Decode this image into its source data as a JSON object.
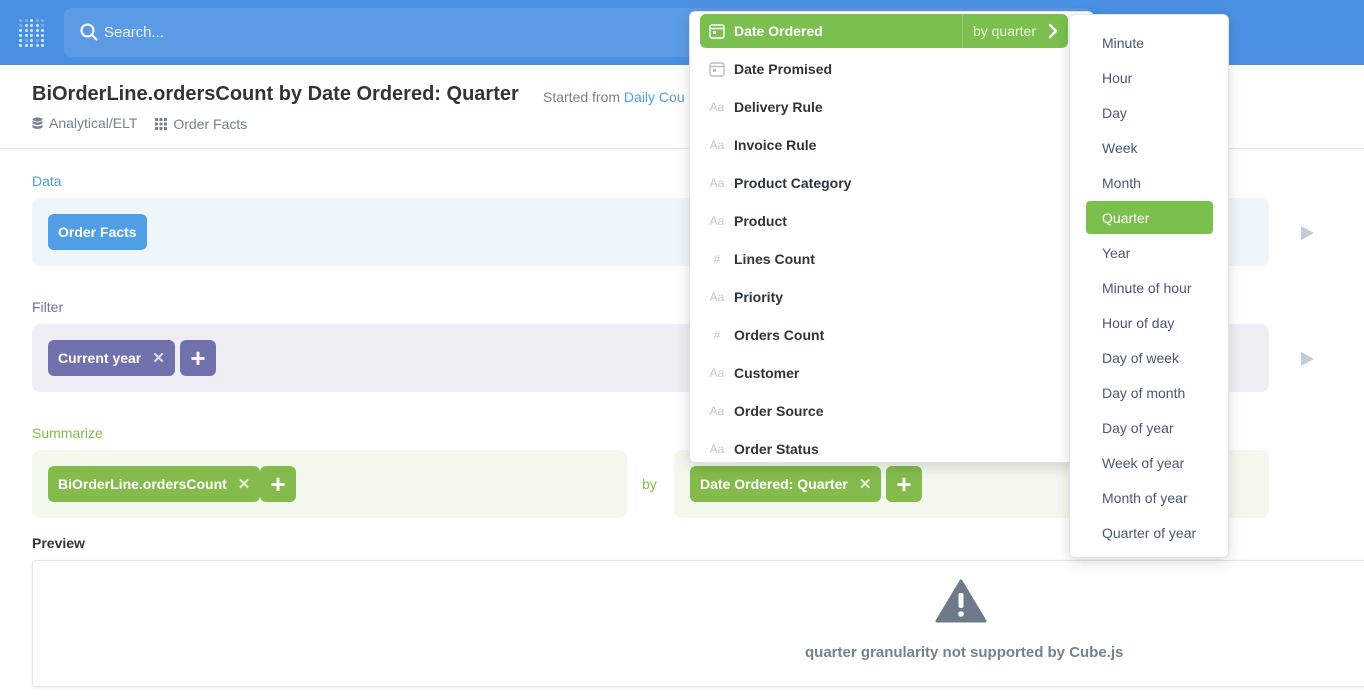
{
  "search": {
    "placeholder": "Search..."
  },
  "header": {
    "title": "BiOrderLine.ordersCount by Date Ordered: Quarter",
    "started_from": "Started from",
    "started_link": "Daily Cou",
    "crumbs": [
      {
        "label": "Analytical/ELT",
        "icon": "database-icon"
      },
      {
        "label": "Order Facts",
        "icon": "grid-icon"
      }
    ]
  },
  "sections": {
    "data": {
      "label": "Data",
      "pill": "Order Facts",
      "color": "#509ee3"
    },
    "filter": {
      "label": "Filter",
      "pill": "Current year",
      "color": "#7172ad"
    },
    "summarize": {
      "label": "Summarize",
      "metric": "BiOrderLine.ordersCount",
      "by": "by",
      "breakout": "Date Ordered: Quarter",
      "color": "#84bb4c"
    }
  },
  "preview": {
    "label": "Preview",
    "error": "quarter granularity not supported by Cube.js"
  },
  "dimension_menu": {
    "items": [
      {
        "label": "Date Ordered",
        "icon": "calendar-icon",
        "active": true,
        "by": "by quarter"
      },
      {
        "label": "Date Promised",
        "icon": "calendar-icon"
      },
      {
        "label": "Delivery Rule",
        "icon": "text-icon",
        "glyph": "Aa"
      },
      {
        "label": "Invoice Rule",
        "icon": "text-icon",
        "glyph": "Aa"
      },
      {
        "label": "Product Category",
        "icon": "text-icon",
        "glyph": "Aa"
      },
      {
        "label": "Product",
        "icon": "text-icon",
        "glyph": "Aa"
      },
      {
        "label": "Lines Count",
        "icon": "number-icon",
        "glyph": "#"
      },
      {
        "label": "Priority",
        "icon": "text-icon",
        "glyph": "Aa"
      },
      {
        "label": "Orders Count",
        "icon": "number-icon",
        "glyph": "#"
      },
      {
        "label": "Customer",
        "icon": "text-icon",
        "glyph": "Aa"
      },
      {
        "label": "Order Source",
        "icon": "text-icon",
        "glyph": "Aa"
      },
      {
        "label": "Order Status",
        "icon": "text-icon",
        "glyph": "Aa"
      }
    ]
  },
  "granularity_menu": {
    "selected": "Quarter",
    "items": [
      "Minute",
      "Hour",
      "Day",
      "Week",
      "Month",
      "Quarter",
      "Year",
      "Minute of hour",
      "Hour of day",
      "Day of week",
      "Day of month",
      "Day of year",
      "Week of year",
      "Month of year",
      "Quarter of year"
    ]
  },
  "colors": {
    "nav": "#4a90e2",
    "data": "#509ee3",
    "filter": "#7172ad",
    "summarize": "#84bb4c",
    "selected": "#7bbf4f"
  }
}
